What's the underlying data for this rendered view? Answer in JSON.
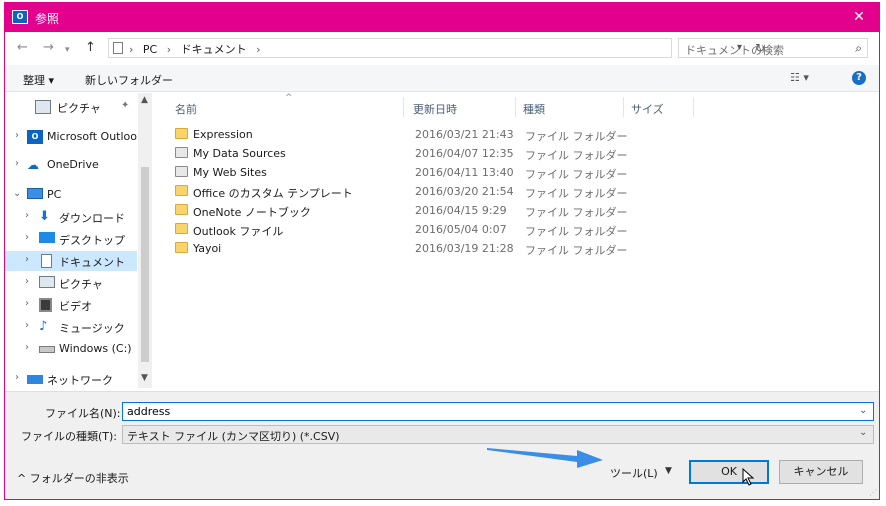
{
  "window": {
    "title": "参照",
    "app_icon": "outlook-icon",
    "accent": "#e3008c"
  },
  "address": {
    "crumbs": [
      "PC",
      "ドキュメント"
    ],
    "search_placeholder": "ドキュメントの検索"
  },
  "toolbar": {
    "organize": "整理 ▾",
    "new_folder": "新しいフォルダー"
  },
  "nav": {
    "items": [
      {
        "label": "ピクチャ",
        "icon": "pictures-icon"
      },
      {
        "label": "Microsoft Outlook",
        "icon": "outlook-icon"
      },
      {
        "label": "OneDrive",
        "icon": "onedrive-icon"
      },
      {
        "label": "PC",
        "icon": "pc-icon"
      },
      {
        "label": "ダウンロード",
        "icon": "download-icon"
      },
      {
        "label": "デスクトップ",
        "icon": "desktop-icon"
      },
      {
        "label": "ドキュメント",
        "icon": "documents-icon"
      },
      {
        "label": "ピクチャ",
        "icon": "pictures-icon"
      },
      {
        "label": "ビデオ",
        "icon": "video-icon"
      },
      {
        "label": "ミュージック",
        "icon": "music-icon"
      },
      {
        "label": "Windows (C:)",
        "icon": "drive-icon"
      },
      {
        "label": "ネットワーク",
        "icon": "network-icon"
      }
    ]
  },
  "columns": {
    "name": "名前",
    "date": "更新日時",
    "type": "種類",
    "size": "サイズ"
  },
  "files": [
    {
      "name": "Expression",
      "date": "2016/03/21 21:43",
      "type": "ファイル フォルダー"
    },
    {
      "name": "My Data Sources",
      "date": "2016/04/07 12:35",
      "type": "ファイル フォルダー"
    },
    {
      "name": "My Web Sites",
      "date": "2016/04/11 13:40",
      "type": "ファイル フォルダー"
    },
    {
      "name": "Office のカスタム テンプレート",
      "date": "2016/03/20 21:54",
      "type": "ファイル フォルダー"
    },
    {
      "name": "OneNote ノートブック",
      "date": "2016/04/15 9:29",
      "type": "ファイル フォルダー"
    },
    {
      "name": "Outlook ファイル",
      "date": "2016/05/04 0:07",
      "type": "ファイル フォルダー"
    },
    {
      "name": "Yayoi",
      "date": "2016/03/19 21:28",
      "type": "ファイル フォルダー"
    }
  ],
  "form": {
    "filename_label": "ファイル名(N):",
    "filename_value": "address",
    "filetype_label": "ファイルの種類(T):",
    "filetype_value": "テキスト ファイル (カンマ区切り) (*.CSV)"
  },
  "footer": {
    "hide_folders": "フォルダーの非表示",
    "tools": "ツール(L)",
    "ok": "OK",
    "cancel": "キャンセル"
  }
}
